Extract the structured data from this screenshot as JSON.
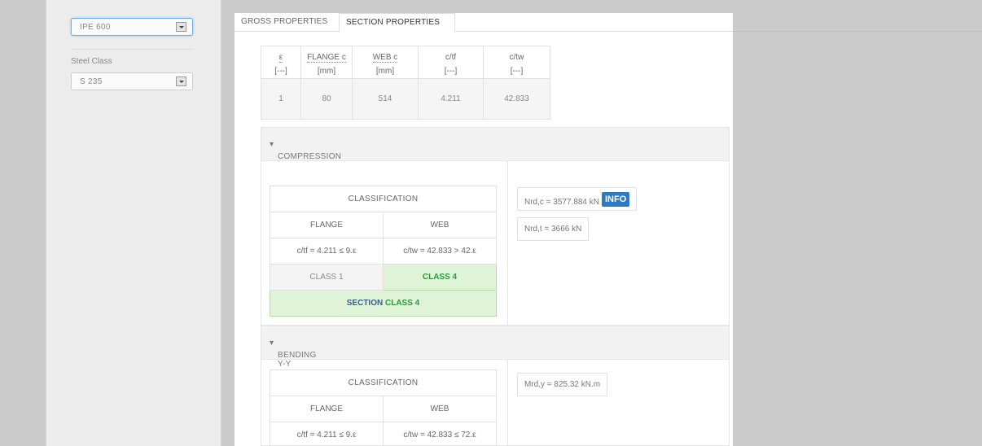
{
  "sidebar": {
    "profile_select": "IPE 600",
    "steel_class_label": "Steel Class",
    "steel_class_select": "S 235"
  },
  "tabs": [
    "GROSS PROPERTIES",
    "SECTION PROPERTIES"
  ],
  "props": {
    "headers": [
      {
        "name": "ε",
        "unit": "[---]"
      },
      {
        "name": "FLANGE c",
        "unit": "[mm]"
      },
      {
        "name": "WEB c",
        "unit": "[mm]"
      },
      {
        "name": "c/tf",
        "unit": "[---]"
      },
      {
        "name": "c/tw",
        "unit": "[---]"
      }
    ],
    "values": [
      "1",
      "80",
      "514",
      "4.211",
      "42.833"
    ]
  },
  "compression": {
    "title": "COMPRESSION",
    "classification_title": "CLASSIFICATION",
    "flange_label": "FLANGE",
    "web_label": "WEB",
    "flange_check": "c/tf = 4.211 ≤ 9.ε",
    "web_check": "c/tw = 42.833 > 42.ε",
    "flange_class": "CLASS 1",
    "web_class": "CLASS 4",
    "section_label": "SECTION",
    "section_class": "CLASS 4",
    "nrd_c": "Nrd,c = 3577.884 kN",
    "info_label": "INFO",
    "nrd_t": "Nrd,t = 3666 kN"
  },
  "bending": {
    "title": "BENDING Y-Y",
    "classification_title": "CLASSIFICATION",
    "flange_label": "FLANGE",
    "web_label": "WEB",
    "flange_check": "c/tf = 4.211 ≤ 9.ε",
    "web_check": "c/tw = 42.833 ≤ 72.ε",
    "mrd": "Mrd,y = 825.32 kN.m"
  },
  "colors": {
    "green_bg": "#dff3d7",
    "green_text": "#2a9a3a",
    "info_bg": "#2d79c2"
  }
}
